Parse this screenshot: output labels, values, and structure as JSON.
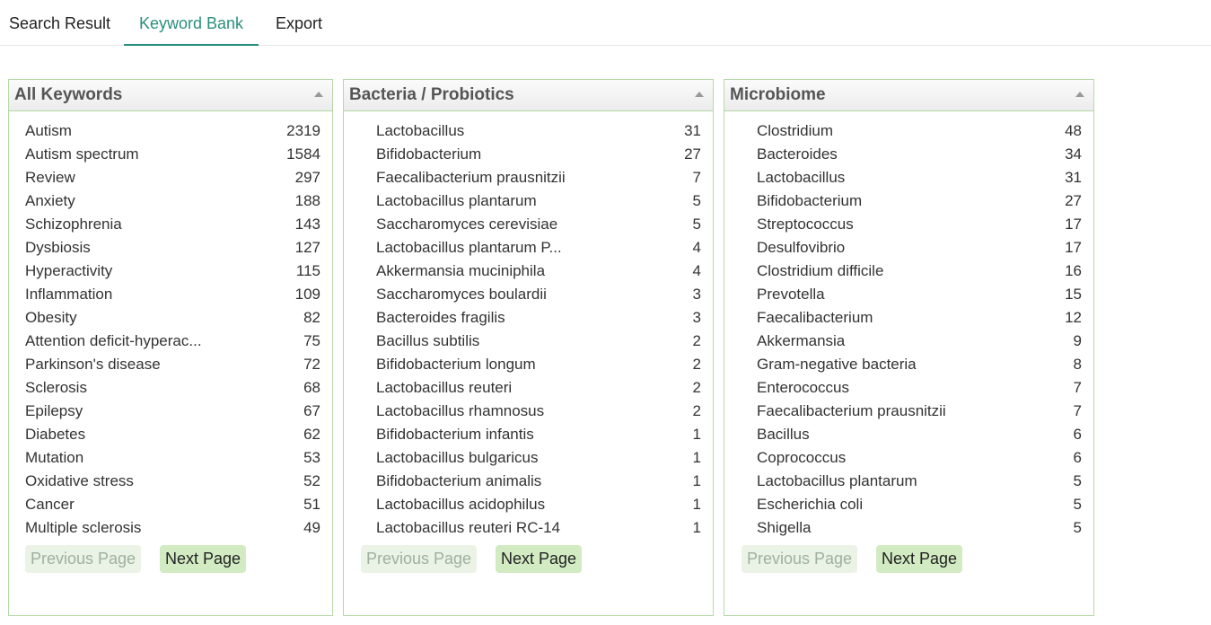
{
  "tabs": [
    {
      "label": "Search Result"
    },
    {
      "label": "Keyword Bank"
    },
    {
      "label": "Export"
    }
  ],
  "active_tab": "Keyword Bank",
  "colors": {
    "accent": "#2a8f7e",
    "panel_border": "#b5d9a6",
    "next_button_bg": "#d2ebc2",
    "prev_button_bg": "#eaf3e5"
  },
  "panels": [
    {
      "title": "All Keywords",
      "prev_label": "Previous Page",
      "next_label": "Next Page",
      "items": [
        {
          "name": "Autism",
          "count": "2319"
        },
        {
          "name": "Autism spectrum",
          "count": "1584"
        },
        {
          "name": "Review",
          "count": "297"
        },
        {
          "name": "Anxiety",
          "count": "188"
        },
        {
          "name": "Schizophrenia",
          "count": "143"
        },
        {
          "name": "Dysbiosis",
          "count": "127"
        },
        {
          "name": "Hyperactivity",
          "count": "115"
        },
        {
          "name": "Inflammation",
          "count": "109"
        },
        {
          "name": "Obesity",
          "count": "82"
        },
        {
          "name": "Attention deficit-hyperac...",
          "count": "75"
        },
        {
          "name": "Parkinson's disease",
          "count": "72"
        },
        {
          "name": "Sclerosis",
          "count": "68"
        },
        {
          "name": "Epilepsy",
          "count": "67"
        },
        {
          "name": "Diabetes",
          "count": "62"
        },
        {
          "name": "Mutation",
          "count": "53"
        },
        {
          "name": "Oxidative stress",
          "count": "52"
        },
        {
          "name": "Cancer",
          "count": "51"
        },
        {
          "name": "Multiple sclerosis",
          "count": "49"
        }
      ]
    },
    {
      "title": "Bacteria / Probiotics",
      "prev_label": "Previous Page",
      "next_label": "Next Page",
      "items": [
        {
          "name": "Lactobacillus",
          "count": "31"
        },
        {
          "name": "Bifidobacterium",
          "count": "27"
        },
        {
          "name": "Faecalibacterium prausnitzii",
          "count": "7"
        },
        {
          "name": "Lactobacillus plantarum",
          "count": "5"
        },
        {
          "name": "Saccharomyces cerevisiae",
          "count": "5"
        },
        {
          "name": "Lactobacillus plantarum P...",
          "count": "4"
        },
        {
          "name": "Akkermansia muciniphila",
          "count": "4"
        },
        {
          "name": "Saccharomyces boulardii",
          "count": "3"
        },
        {
          "name": "Bacteroides fragilis",
          "count": "3"
        },
        {
          "name": "Bacillus subtilis",
          "count": "2"
        },
        {
          "name": "Bifidobacterium longum",
          "count": "2"
        },
        {
          "name": "Lactobacillus reuteri",
          "count": "2"
        },
        {
          "name": "Lactobacillus rhamnosus",
          "count": "2"
        },
        {
          "name": "Bifidobacterium infantis",
          "count": "1"
        },
        {
          "name": "Lactobacillus bulgaricus",
          "count": "1"
        },
        {
          "name": "Bifidobacterium animalis",
          "count": "1"
        },
        {
          "name": "Lactobacillus acidophilus",
          "count": "1"
        },
        {
          "name": "Lactobacillus reuteri RC-14",
          "count": "1"
        }
      ]
    },
    {
      "title": "Microbiome",
      "prev_label": "Previous Page",
      "next_label": "Next Page",
      "items": [
        {
          "name": "Clostridium",
          "count": "48"
        },
        {
          "name": "Bacteroides",
          "count": "34"
        },
        {
          "name": "Lactobacillus",
          "count": "31"
        },
        {
          "name": "Bifidobacterium",
          "count": "27"
        },
        {
          "name": "Streptococcus",
          "count": "17"
        },
        {
          "name": "Desulfovibrio",
          "count": "17"
        },
        {
          "name": "Clostridium difficile",
          "count": "16"
        },
        {
          "name": "Prevotella",
          "count": "15"
        },
        {
          "name": "Faecalibacterium",
          "count": "12"
        },
        {
          "name": "Akkermansia",
          "count": "9"
        },
        {
          "name": "Gram-negative bacteria",
          "count": "8"
        },
        {
          "name": "Enterococcus",
          "count": "7"
        },
        {
          "name": "Faecalibacterium prausnitzii",
          "count": "7"
        },
        {
          "name": "Bacillus",
          "count": "6"
        },
        {
          "name": "Coprococcus",
          "count": "6"
        },
        {
          "name": "Lactobacillus plantarum",
          "count": "5"
        },
        {
          "name": "Escherichia coli",
          "count": "5"
        },
        {
          "name": "Shigella",
          "count": "5"
        }
      ]
    }
  ]
}
